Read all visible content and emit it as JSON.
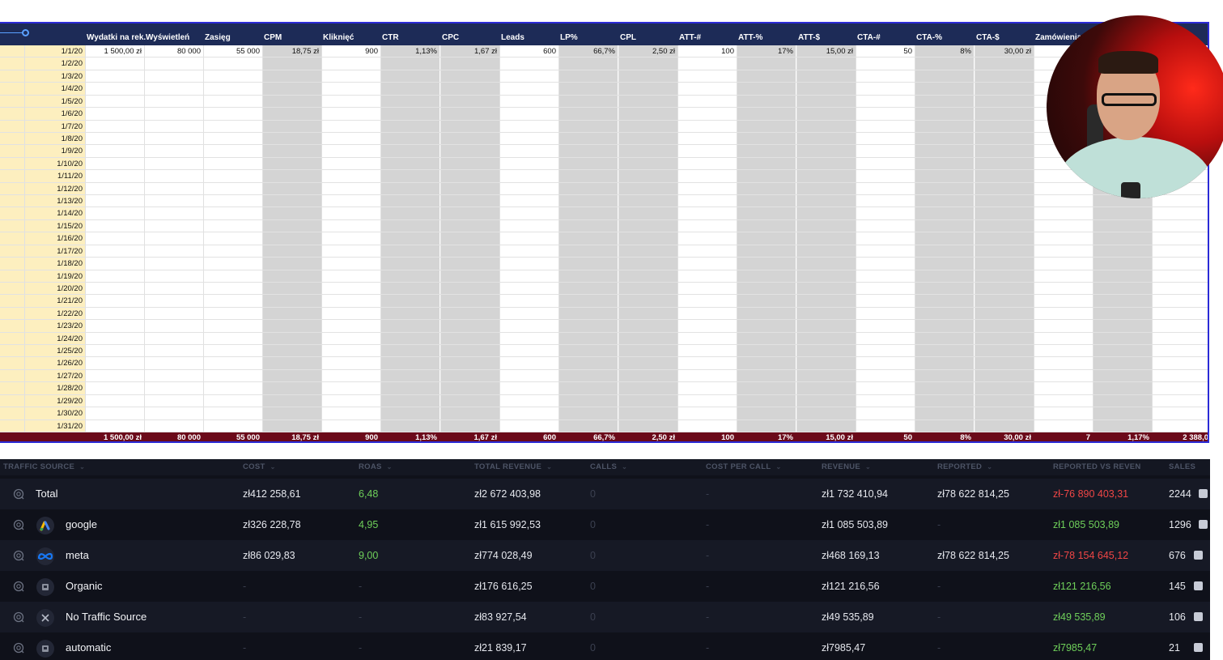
{
  "sheet": {
    "headers": [
      "Wydatki na rek.",
      "Wyświetleń",
      "Zasięg",
      "CPM",
      "Kliknięć",
      "CTR",
      "CPC",
      "Leads",
      "LP%",
      "CPL",
      "ATT-#",
      "ATT-%",
      "ATT-$",
      "CTA-#",
      "CTA-%",
      "CTA-$",
      "Zamówienia"
    ],
    "dates": [
      "1/1/20",
      "1/2/20",
      "1/3/20",
      "1/4/20",
      "1/5/20",
      "1/6/20",
      "1/7/20",
      "1/8/20",
      "1/9/20",
      "1/10/20",
      "1/11/20",
      "1/12/20",
      "1/13/20",
      "1/14/20",
      "1/15/20",
      "1/16/20",
      "1/17/20",
      "1/18/20",
      "1/19/20",
      "1/20/20",
      "1/21/20",
      "1/22/20",
      "1/23/20",
      "1/24/20",
      "1/25/20",
      "1/26/20",
      "1/27/20",
      "1/28/20",
      "1/29/20",
      "1/30/20",
      "1/31/20"
    ],
    "first_row": [
      "1 500,00 zł",
      "80 000",
      "55 000",
      "18,75 zł",
      "900",
      "1,13%",
      "1,67 zł",
      "600",
      "66,7%",
      "2,50 zł",
      "100",
      "17%",
      "15,00 zł",
      "50",
      "8%",
      "30,00 zł"
    ],
    "totals": [
      "1 500,00 zł",
      "80 000",
      "55 000",
      "18,75 zł",
      "900",
      "1,13%",
      "1,67 zł",
      "600",
      "66,7%",
      "2,50 zł",
      "100",
      "17%",
      "15,00 zł",
      "50",
      "8%",
      "30,00 zł",
      "7",
      "1,17%",
      "2 388,0"
    ]
  },
  "traffic": {
    "headers": {
      "source": "TRAFFIC SOURCE",
      "cost": "COST",
      "roas": "ROAS",
      "total_revenue": "TOTAL REVENUE",
      "calls": "CALLS",
      "cost_per_call": "COST PER CALL",
      "revenue": "REVENUE",
      "reported": "REPORTED",
      "reported_vs_revenue": "REPORTED VS REVEN",
      "sales": "SALES"
    },
    "rows": [
      {
        "name": "Total",
        "icon": "",
        "cost": "zł412 258,61",
        "roas": "6,48",
        "total_revenue": "zł2 672 403,98",
        "calls": "0",
        "cost_per_call": "-",
        "revenue": "zł1 732 410,94",
        "reported": "zł78 622 814,25",
        "rvr": "zł-76 890 403,31",
        "sales": "2244"
      },
      {
        "name": "google",
        "icon": "google-ads-icon",
        "cost": "zł326 228,78",
        "roas": "4,95",
        "total_revenue": "zł1 615 992,53",
        "calls": "0",
        "cost_per_call": "-",
        "revenue": "zł1 085 503,89",
        "reported": "-",
        "rvr": "zł1 085 503,89",
        "sales": "1296"
      },
      {
        "name": "meta",
        "icon": "meta-icon",
        "cost": "zł86 029,83",
        "roas": "9,00",
        "total_revenue": "zł774 028,49",
        "calls": "0",
        "cost_per_call": "-",
        "revenue": "zł468 169,13",
        "reported": "zł78 622 814,25",
        "rvr": "zł-78 154 645,12",
        "sales": "676"
      },
      {
        "name": "Organic",
        "icon": "organic-icon",
        "cost": "-",
        "roas": "-",
        "total_revenue": "zł176 616,25",
        "calls": "0",
        "cost_per_call": "-",
        "revenue": "zł121 216,56",
        "reported": "-",
        "rvr": "zł121 216,56",
        "sales": "145"
      },
      {
        "name": "No Traffic Source",
        "icon": "close-icon",
        "cost": "-",
        "roas": "-",
        "total_revenue": "zł83 927,54",
        "calls": "0",
        "cost_per_call": "-",
        "revenue": "zł49 535,89",
        "reported": "-",
        "rvr": "zł49 535,89",
        "sales": "106"
      },
      {
        "name": "automatic",
        "icon": "automatic-icon",
        "cost": "-",
        "roas": "-",
        "total_revenue": "zł21 839,17",
        "calls": "0",
        "cost_per_call": "-",
        "revenue": "zł7985,47",
        "reported": "-",
        "rvr": "zł7985,47",
        "sales": "21"
      }
    ]
  },
  "colors": {
    "sheet_header": "#1d2b57",
    "date_band": "#fdefbf",
    "total_row": "#6b0a1a",
    "traffic_bg": "#0f111a",
    "positive": "#6fd05a",
    "negative": "#f04646"
  }
}
